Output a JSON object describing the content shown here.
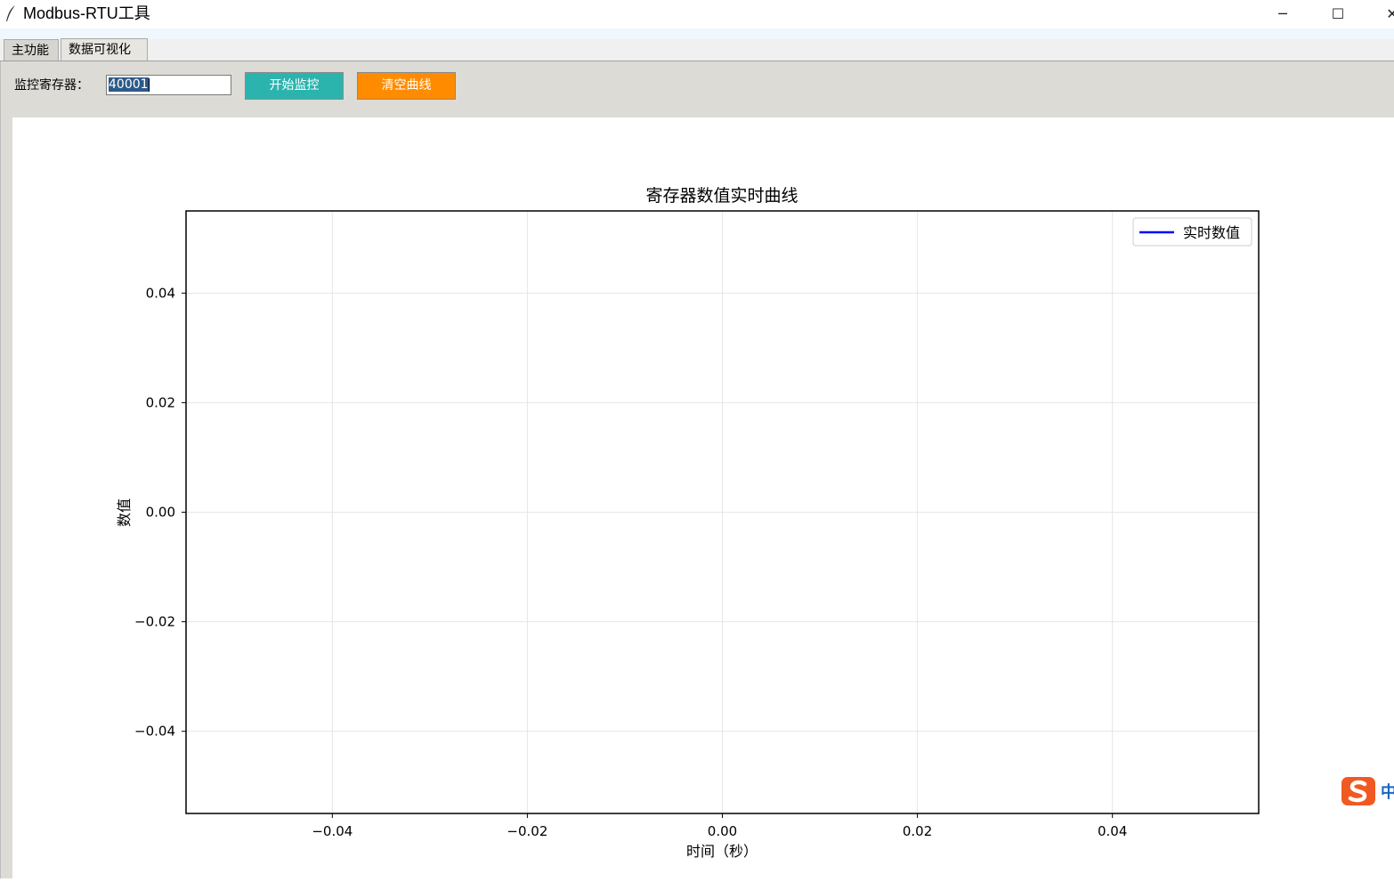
{
  "window": {
    "title": "Modbus-RTU工具",
    "minimize_label": "─",
    "maximize_label": "☐",
    "close_label": "✕"
  },
  "tabs": [
    {
      "label": "主功能"
    },
    {
      "label": "数据可视化"
    }
  ],
  "controls": {
    "register_label": "监控寄存器：",
    "register_value": "40001",
    "start_label": "开始监控",
    "clear_label": "清空曲线",
    "start_color": "#2bb4ae",
    "clear_color": "#ff8c00"
  },
  "chart_data": {
    "type": "line",
    "title": "寄存器数值实时曲线",
    "xlabel": "时间（秒）",
    "ylabel": "数值",
    "xlim": [
      -0.055,
      0.055
    ],
    "ylim": [
      -0.055,
      0.055
    ],
    "x_ticks": [
      -0.04,
      -0.02,
      0.0,
      0.02,
      0.04
    ],
    "x_tick_labels": [
      "−0.04",
      "−0.02",
      "0.00",
      "0.02",
      "0.04"
    ],
    "y_ticks": [
      0.04,
      0.02,
      0.0,
      -0.02,
      -0.04
    ],
    "y_tick_labels": [
      "0.04",
      "0.02",
      "0.00",
      "−0.02",
      "−0.04"
    ],
    "grid": true,
    "legend_position": "top-right",
    "series": [
      {
        "name": "实时数值",
        "color": "#0000ff",
        "x": [],
        "y": []
      }
    ]
  },
  "ime": {
    "label": "中"
  }
}
